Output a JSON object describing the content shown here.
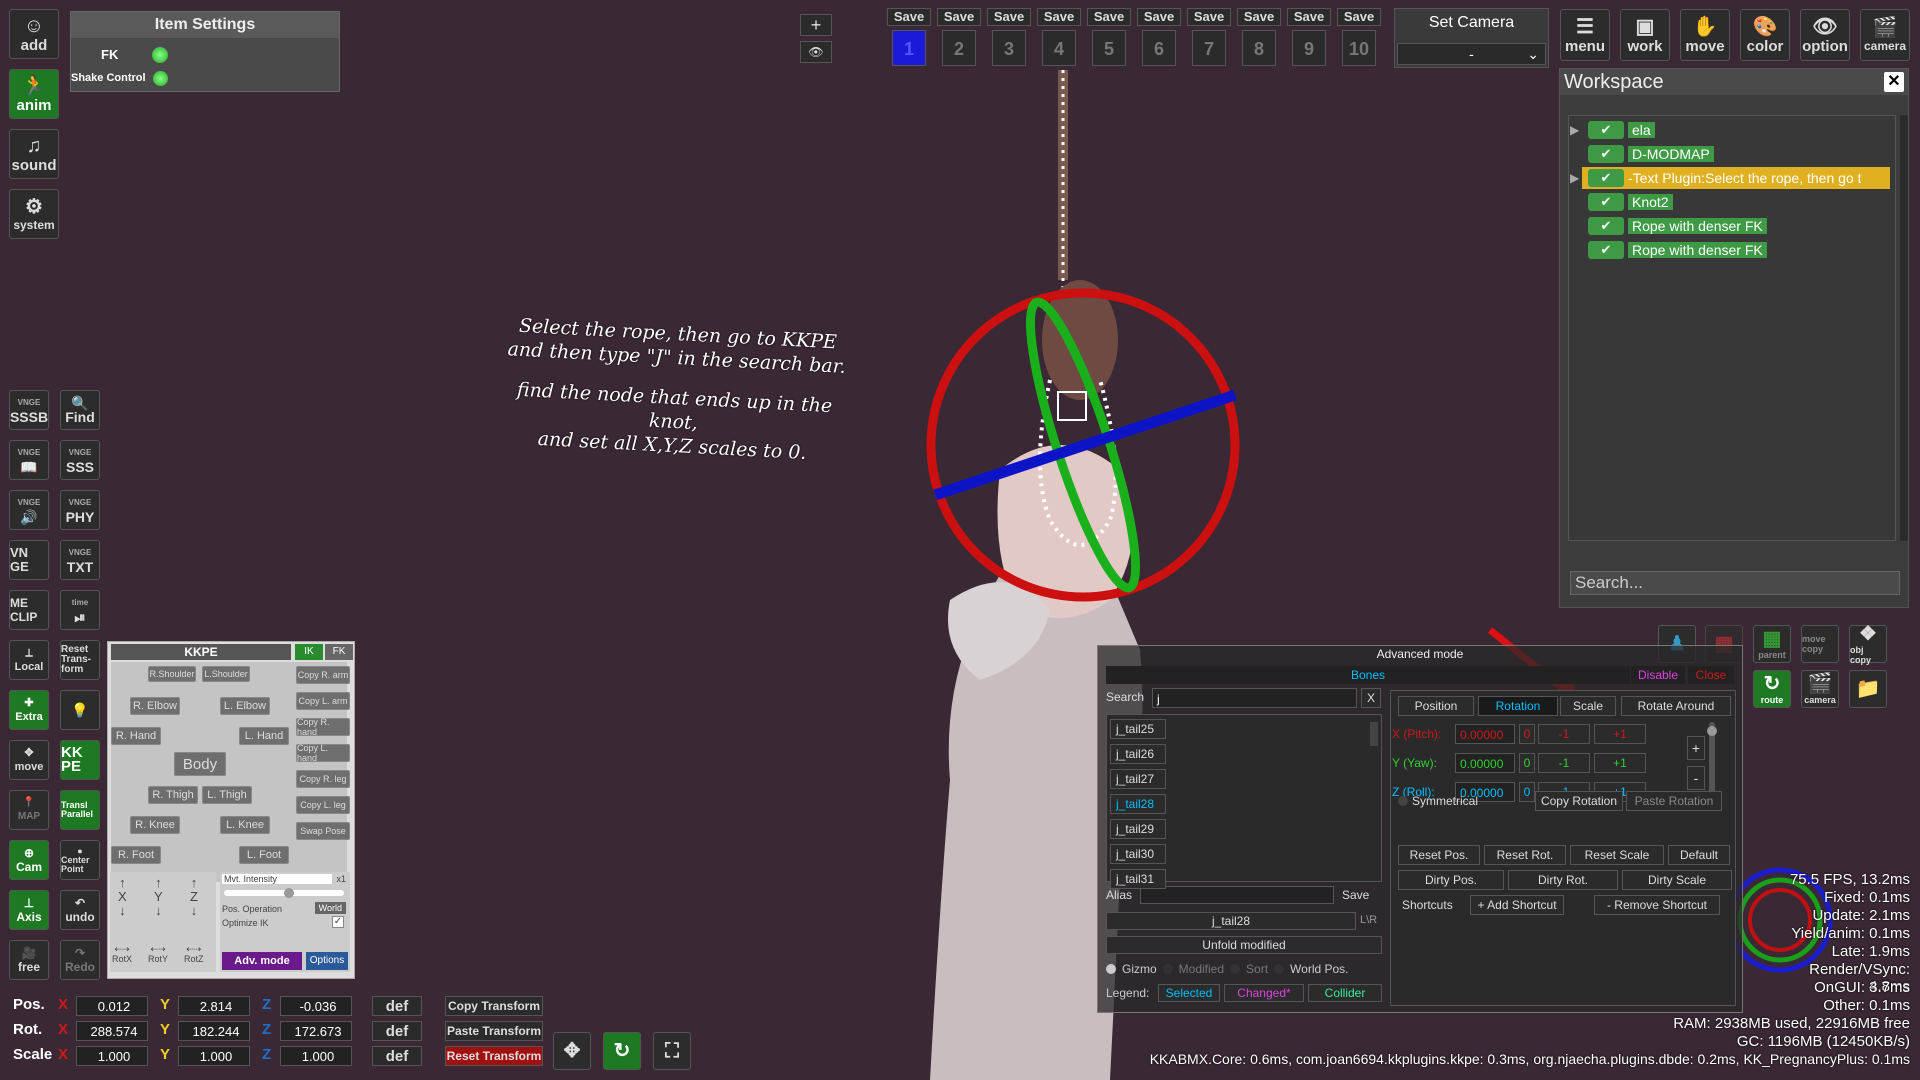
{
  "left_toolbar": {
    "add": "add",
    "anim": "anim",
    "sound": "sound",
    "system": "system"
  },
  "item_settings": {
    "title": "Item Settings",
    "fk_label": "FK",
    "shake_label": "Shake Control"
  },
  "saves": {
    "label": "Save",
    "slots": [
      "1",
      "2",
      "3",
      "4",
      "5",
      "6",
      "7",
      "8",
      "9",
      "10"
    ]
  },
  "camera": {
    "title": "Set Camera",
    "value": "-"
  },
  "top_right_menu": {
    "menu": "menu",
    "work": "work",
    "move": "move",
    "color": "color",
    "option": "option",
    "camera": "camera"
  },
  "workspace": {
    "title": "Workspace",
    "items": [
      {
        "label": "ela",
        "expand": true,
        "highlight": false
      },
      {
        "label": "D-MODMAP",
        "expand": false,
        "highlight": false
      },
      {
        "label": "-Text Plugin:Select the rope, then go t",
        "expand": true,
        "highlight": true
      },
      {
        "label": "Knot2",
        "expand": false,
        "highlight": false
      },
      {
        "label": "Rope with denser FK",
        "expand": false,
        "highlight": false
      },
      {
        "label": "Rope with denser FK",
        "expand": false,
        "highlight": false
      }
    ],
    "search_placeholder": "Search...",
    "tools": {
      "parent": "parent",
      "move_copy": "move copy",
      "obj_copy": "obj copy",
      "route": "route",
      "camera": "camera"
    }
  },
  "annotation": {
    "line1": "Select the rope, then go to KKPE",
    "line2": "and then type \"J\" in the search bar.",
    "line3": "find the node that ends up in the knot,",
    "line4": "and set all X,Y,Z scales to 0."
  },
  "view_controls": {
    "plus": "+"
  },
  "vnge": {
    "tag": "VNGE",
    "sssb": "SSSB",
    "find": "Find",
    "sss": "SSS",
    "phy": "PHY",
    "vnge": "VN GE",
    "txt": "TXT",
    "me_clip": "ME CLIP",
    "time_tag": "time",
    "local": "Local",
    "reset": "Reset Trans- form",
    "extra": "Extra",
    "move": "move",
    "kkpe": "KK PE",
    "map": "MAP",
    "transl": "Transl Parallel",
    "cam": "Cam",
    "center": "Center Point",
    "axis": "Axis",
    "undo": "undo",
    "free": "free",
    "redo": "Redo"
  },
  "kkpe": {
    "title": "KKPE",
    "ik": "IK",
    "fk": "FK",
    "r_shoulder": "R.Shoulder",
    "l_shoulder": "L.Shoulder",
    "r_elbow": "R. Elbow",
    "l_elbow": "L. Elbow",
    "r_hand": "R. Hand",
    "l_hand": "L. Hand",
    "body": "Body",
    "r_thigh": "R. Thigh",
    "l_thigh": "L. Thigh",
    "r_knee": "R. Knee",
    "l_knee": "L. Knee",
    "r_foot": "R. Foot",
    "l_foot": "L. Foot",
    "copy_r_arm": "Copy R. arm",
    "copy_l_arm": "Copy L. arm",
    "copy_r_hand": "Copy R. hand",
    "copy_l_hand": "Copy L. hand",
    "copy_r_leg": "Copy R. leg",
    "copy_l_leg": "Copy L. leg",
    "swap_pose": "Swap Pose",
    "x": "X",
    "y": "Y",
    "z": "Z",
    "rotx": "RotX",
    "roty": "RotY",
    "rotz": "RotZ",
    "mvt_intensity": "Mvt. Intensity",
    "x1": "x1",
    "pos_operation": "Pos. Operation",
    "world": "World",
    "optimize_ik": "Optimize IK",
    "adv_mode": "Adv. mode",
    "options": "Options"
  },
  "transform": {
    "pos_label": "Pos.",
    "rot_label": "Rot.",
    "scale_label": "Scale",
    "x": "X",
    "y": "Y",
    "z": "Z",
    "pos": [
      "0.012",
      "2.814",
      "-0.036"
    ],
    "rot": [
      "288.574",
      "182.244",
      "172.673"
    ],
    "scale": [
      "1.000",
      "1.000",
      "1.000"
    ],
    "def": "def",
    "copy": "Copy Transform",
    "paste": "Paste Transform",
    "reset": "Reset Transform"
  },
  "advanced": {
    "title": "Advanced mode",
    "bones": "Bones",
    "disable": "Disable",
    "close": "Close",
    "search_label": "Search",
    "search_value": "j",
    "search_clear": "X",
    "bones_list": [
      "j_tail25",
      "j_tail26",
      "j_tail27",
      "j_tail28",
      "j_tail29",
      "j_tail30",
      "j_tail31"
    ],
    "selected_bone": "j_tail28",
    "alias_label": "Alias",
    "alias_save": "Save",
    "current_bone": "j_tail28",
    "lr": "L\\R",
    "unfold": "Unfold modified",
    "gizmo": "Gizmo",
    "modified": "Modified",
    "sort": "Sort",
    "world_pos": "World Pos.",
    "legend": "Legend:",
    "leg_selected": "Selected",
    "leg_changed": "Changed*",
    "leg_collider": "Collider",
    "tabs": [
      "Position",
      "Rotation",
      "Scale",
      "Rotate Around"
    ],
    "active_tab": "Rotation",
    "x_label": "X (Pitch):",
    "y_label": "Y (Yaw):",
    "z_label": "Z (Roll):",
    "x_val": "0.00000",
    "y_val": "0.00000",
    "z_val": "0.00000",
    "zero": "0",
    "minus1": "-1",
    "plus1": "+1",
    "plus": "+",
    "minus": "-",
    "symmetrical": "Symmetrical",
    "copy_rot": "Copy Rotation",
    "paste_rot": "Paste Rotation",
    "reset_pos": "Reset Pos.",
    "reset_rot": "Reset Rot.",
    "reset_scale": "Reset Scale",
    "default": "Default",
    "dirty_pos": "Dirty Pos.",
    "dirty_rot": "Dirty Rot.",
    "dirty_scale": "Dirty Scale",
    "shortcuts": "Shortcuts",
    "add_shortcut": "+ Add Shortcut",
    "remove_shortcut": "- Remove Shortcut"
  },
  "stats": [
    "75.5 FPS, 13.2ms",
    "Fixed: 0.1ms",
    "Update: 2.1ms",
    "Yield/anim: 0.1ms",
    "Late: 1.9ms",
    "Render/VSync: 4.8ms",
    "OnGUI: 3.7ms",
    "Other: 0.1ms",
    "RAM: 2938MB used, 22916MB free",
    "GC: 1196MB (12450KB/s)",
    "KKABMX.Core: 0.6ms, com.joan6694.kkplugins.kkpe: 0.3ms, org.njaecha.plugins.dbde: 0.2ms, KK_PregnancyPlus: 0.1ms"
  ],
  "colors": {
    "bg": "#3a2835",
    "accent_blue": "#00bfff",
    "green": "#3e9a44",
    "red": "#d01818"
  }
}
